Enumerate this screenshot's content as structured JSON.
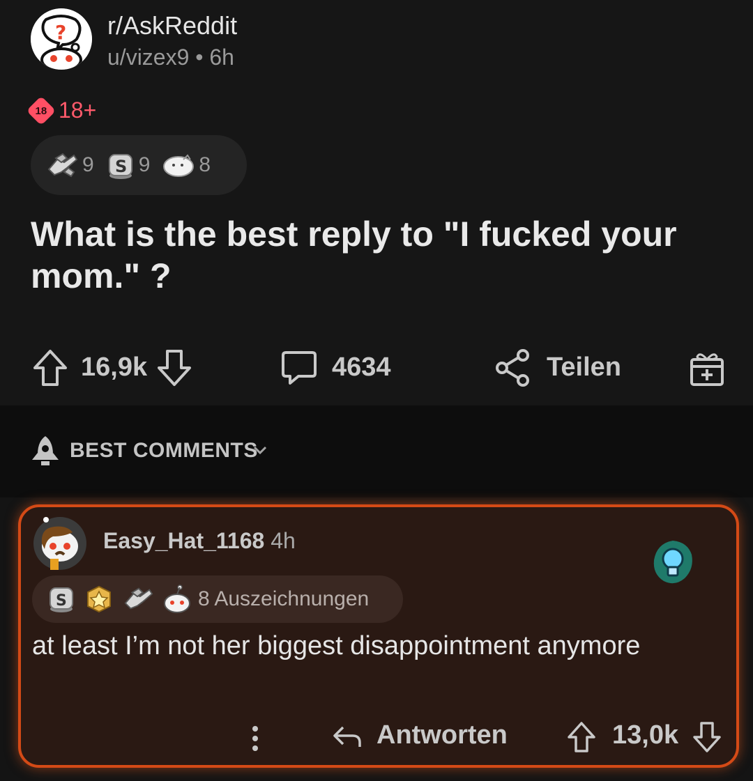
{
  "post": {
    "subreddit": "r/AskReddit",
    "user": "u/vizex9",
    "separator": "•",
    "age": "6h",
    "nsfw_badge": "18",
    "nsfw_label": "18+",
    "awards": [
      {
        "icon": "handshake-award-icon",
        "count": "9"
      },
      {
        "icon": "silver-award-icon",
        "count": "9"
      },
      {
        "icon": "blob-award-icon",
        "count": "8"
      }
    ],
    "title": "What is the best reply to \"I fucked your mom.\" ?",
    "score": "16,9k",
    "comments": "4634",
    "share_label": "Teilen"
  },
  "sort": {
    "label": "BEST COMMENTS"
  },
  "comment": {
    "author": "Easy_Hat_1168",
    "age": "4h",
    "awards_label": "8 Auszeichnungen",
    "body": "at least I’m not her biggest disappointment anymore",
    "reply_label": "Antworten",
    "score": "13,0k"
  },
  "colors": {
    "accent_orange": "#d44a16",
    "nsfw_red": "#ff4f64",
    "background": "#161616"
  }
}
